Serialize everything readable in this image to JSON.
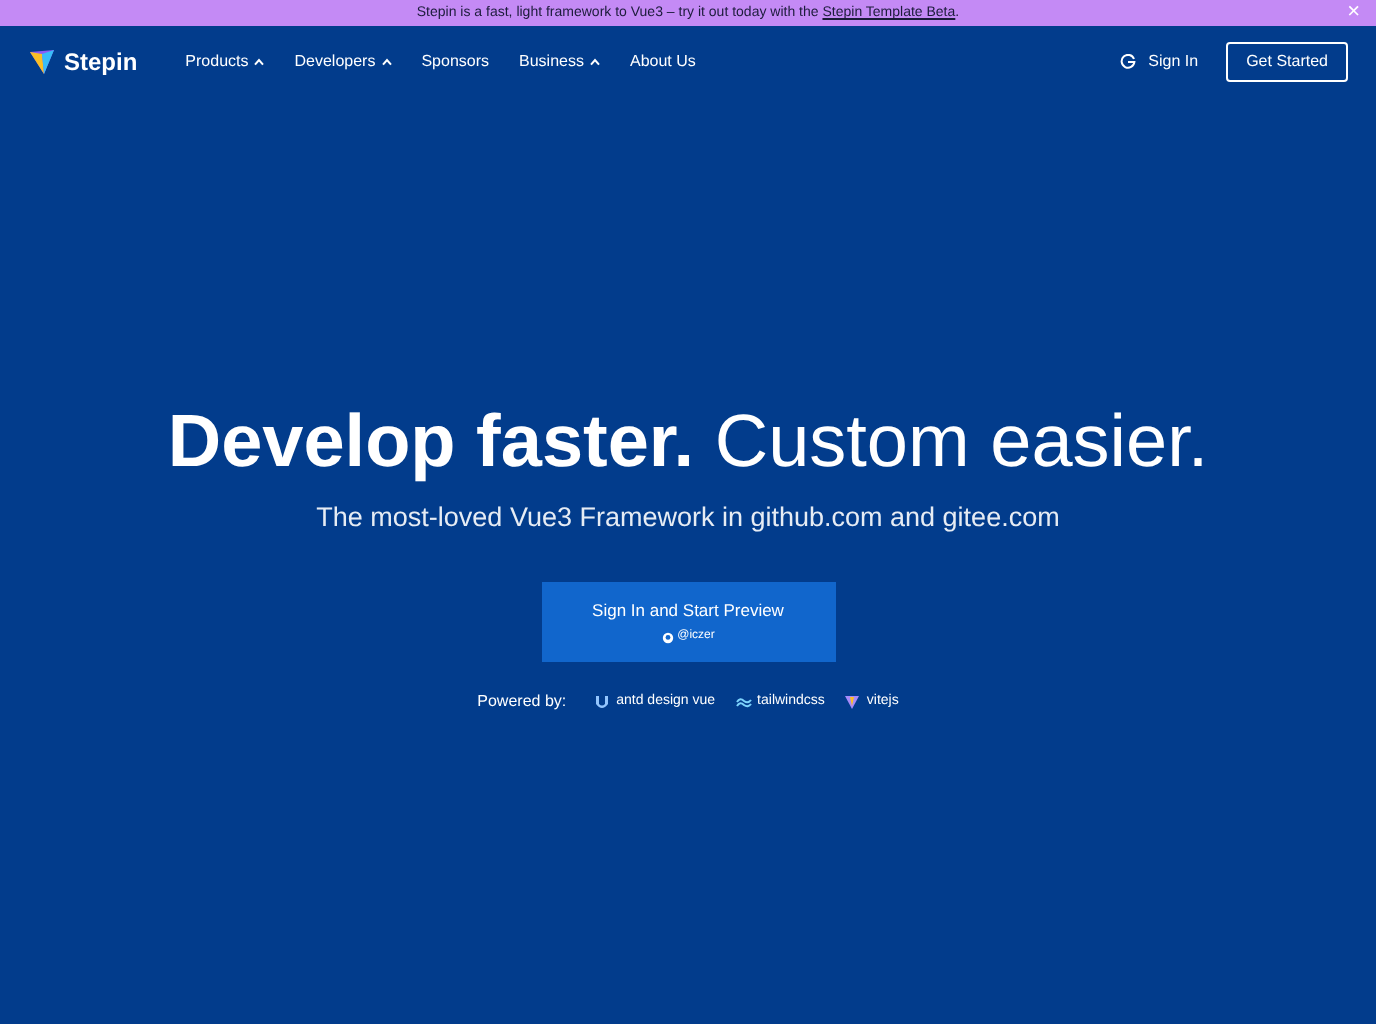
{
  "banner": {
    "text": "Stepin is a fast, light framework to Vue3 – try it out today with the",
    "link": "Stepin Template Beta",
    "end": ".",
    "close": "×"
  },
  "header": {
    "logo": "Stepin",
    "nav": [
      {
        "label": "Products",
        "has_menu": true
      },
      {
        "label": "Developers",
        "has_menu": true
      },
      {
        "label": "Sponsors",
        "has_menu": false
      },
      {
        "label": "Business",
        "has_menu": true
      },
      {
        "label": "About Us",
        "has_menu": false
      }
    ],
    "sign_in": "Sign In",
    "get_started": "Get Started"
  },
  "hero": {
    "title": "**Develop faster.** Custom easier.",
    "subtitle": "The most-loved Vue3 Framework in github.com and gitee.com",
    "cta": {
      "label": "Sign In and Start Preview",
      "sub": "@iczer"
    },
    "powered_label": "Powered by:",
    "powered": [
      {
        "kind": "antd",
        "label": "antd design vue"
      },
      {
        "kind": "tailwind",
        "label": "tailwindcss"
      },
      {
        "kind": "vite",
        "label": "vitejs"
      }
    ]
  }
}
